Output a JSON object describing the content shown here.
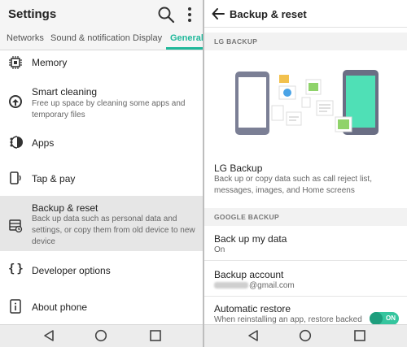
{
  "left": {
    "title": "Settings",
    "tabs": [
      {
        "label": "Networks",
        "active": false
      },
      {
        "label": "Sound & notification",
        "active": false
      },
      {
        "label": "Display",
        "active": false
      },
      {
        "label": "General",
        "active": true
      }
    ],
    "items": [
      {
        "title": "Memory",
        "subtitle": "",
        "icon": "memory-chip-icon"
      },
      {
        "title": "Smart cleaning",
        "subtitle": "Free up space by cleaning some apps and temporary files",
        "icon": "smart-cleaning-icon"
      },
      {
        "title": "Apps",
        "subtitle": "",
        "icon": "apps-icon"
      },
      {
        "title": "Tap & pay",
        "subtitle": "",
        "icon": "tap-pay-icon"
      },
      {
        "title": "Backup & reset",
        "subtitle": "Back up data such as personal data and settings, or copy them from old device to new device",
        "icon": "backup-reset-icon",
        "selected": true
      },
      {
        "title": "Developer options",
        "subtitle": "",
        "icon": "developer-braces-icon"
      },
      {
        "title": "About phone",
        "subtitle": "",
        "icon": "info-icon"
      }
    ]
  },
  "right": {
    "title": "Backup & reset",
    "section_lg": "LG BACKUP",
    "lg_backup": {
      "title": "LG Backup",
      "subtitle": "Back up or copy data such as call reject list, messages, images, and Home screens"
    },
    "section_google": "GOOGLE BACKUP",
    "backup_my_data": {
      "title": "Back up my data",
      "value": "On"
    },
    "backup_account": {
      "title": "Backup account",
      "value": "@gmail.com"
    },
    "automatic_restore": {
      "title": "Automatic restore",
      "subtitle": "When reinstalling an app, restore backed",
      "toggle": "ON"
    }
  },
  "colors": {
    "accent": "#1fb89a",
    "toggle": "#35c59e",
    "selected_row": "#e6e6e6",
    "phone_left": "#7b7f95",
    "phone_screen_right": "#4fe0b6"
  }
}
